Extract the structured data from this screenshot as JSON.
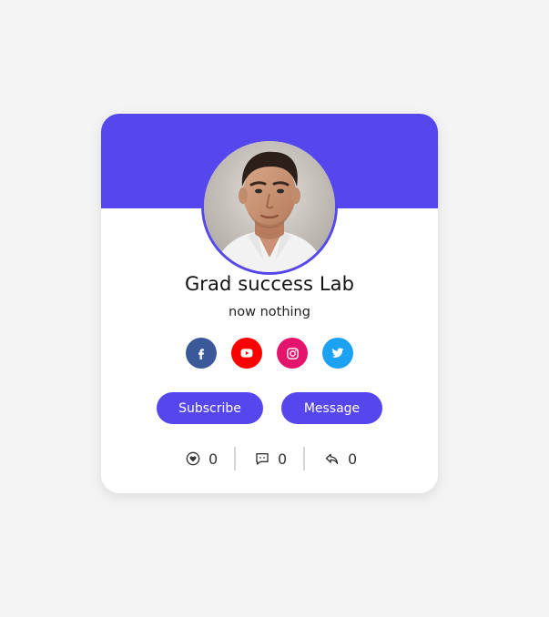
{
  "colors": {
    "accent": "#5546ee",
    "page_background": "#f4f4f4",
    "card_background": "#ffffff",
    "facebook": "#3b5998",
    "youtube": "#ff0000",
    "instagram": "#e4136b",
    "twitter": "#1da1f2"
  },
  "profile": {
    "name": "Grad success Lab",
    "tagline": "now nothing",
    "avatar_description": "profile photo"
  },
  "social_links": [
    {
      "icon": "facebook-icon"
    },
    {
      "icon": "youtube-icon"
    },
    {
      "icon": "instagram-icon"
    },
    {
      "icon": "twitter-icon"
    }
  ],
  "actions": {
    "subscribe_label": "Subscribe",
    "message_label": "Message"
  },
  "stats": {
    "likes": "0",
    "comments": "0",
    "shares": "0"
  }
}
